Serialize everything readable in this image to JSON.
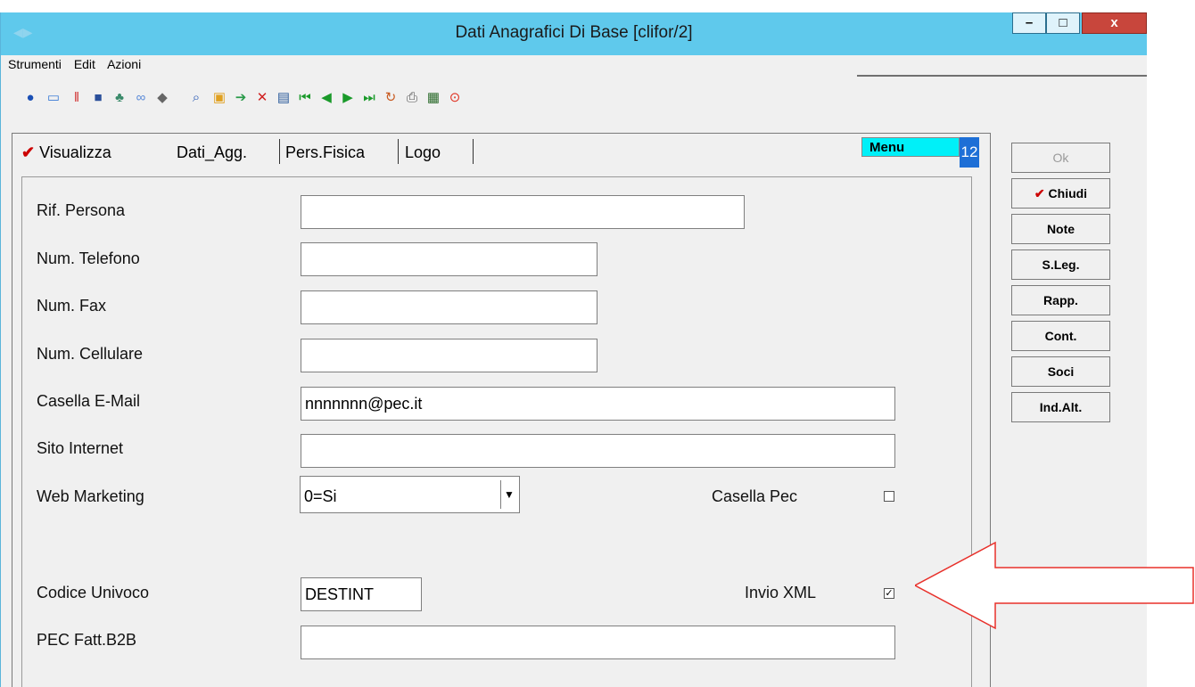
{
  "window": {
    "title": "Dati Anagrafici Di Base [clifor/2]",
    "controls": {
      "minimize": "–",
      "maximize": "□",
      "close": "x"
    }
  },
  "menu": [
    "Strumenti",
    "Edit",
    "Azioni"
  ],
  "toolbar_icons": [
    "help-icon",
    "chat-icon",
    "marker-icon",
    "monitor-icon",
    "users-icon",
    "link-icon",
    "diamond-icon",
    "search-icon",
    "folder-icon",
    "export-icon",
    "delete-icon",
    "table-icon",
    "first-icon",
    "prev-icon",
    "next-icon",
    "last-icon",
    "refresh-icon",
    "print-icon",
    "save-icon",
    "stop-icon"
  ],
  "tabs": [
    {
      "label": "Visualizza",
      "checked": true
    },
    {
      "label": "Dati_Agg."
    },
    {
      "label": "Pers.Fisica"
    },
    {
      "label": "Logo"
    }
  ],
  "menu_label": "Menu",
  "num_label": "12",
  "form": {
    "rif_persona": {
      "label": "Rif. Persona",
      "value": ""
    },
    "num_telefono": {
      "label": "Num. Telefono",
      "value": ""
    },
    "num_fax": {
      "label": "Num. Fax",
      "value": ""
    },
    "num_cellulare": {
      "label": "Num. Cellulare",
      "value": ""
    },
    "casella_email": {
      "label": "Casella E-Mail",
      "value": "nnnnnnn@pec.it"
    },
    "sito_internet": {
      "label": "Sito Internet",
      "value": ""
    },
    "web_marketing": {
      "label": "Web Marketing",
      "value": "0=Si"
    },
    "casella_pec": {
      "label": "Casella Pec",
      "checked": false
    },
    "codice_univoco": {
      "label": "Codice Univoco",
      "value": "DESTINT"
    },
    "invio_xml": {
      "label": "Invio XML",
      "checked": true,
      "mark": "✓"
    },
    "pec_fatt_b2b": {
      "label": "PEC Fatt.B2B",
      "value": ""
    }
  },
  "side_buttons": {
    "ok": "Ok",
    "chiudi": "Chiudi",
    "note": "Note",
    "s_leg": "S.Leg.",
    "rapp": "Rapp.",
    "cont": "Cont.",
    "soci": "Soci",
    "ind_alt": "Ind.Alt."
  },
  "colors": {
    "titlebar": "#5fc9ec",
    "menu_label": "#00f0f8",
    "check": "#cc0000",
    "annotation": "#e8302a"
  }
}
